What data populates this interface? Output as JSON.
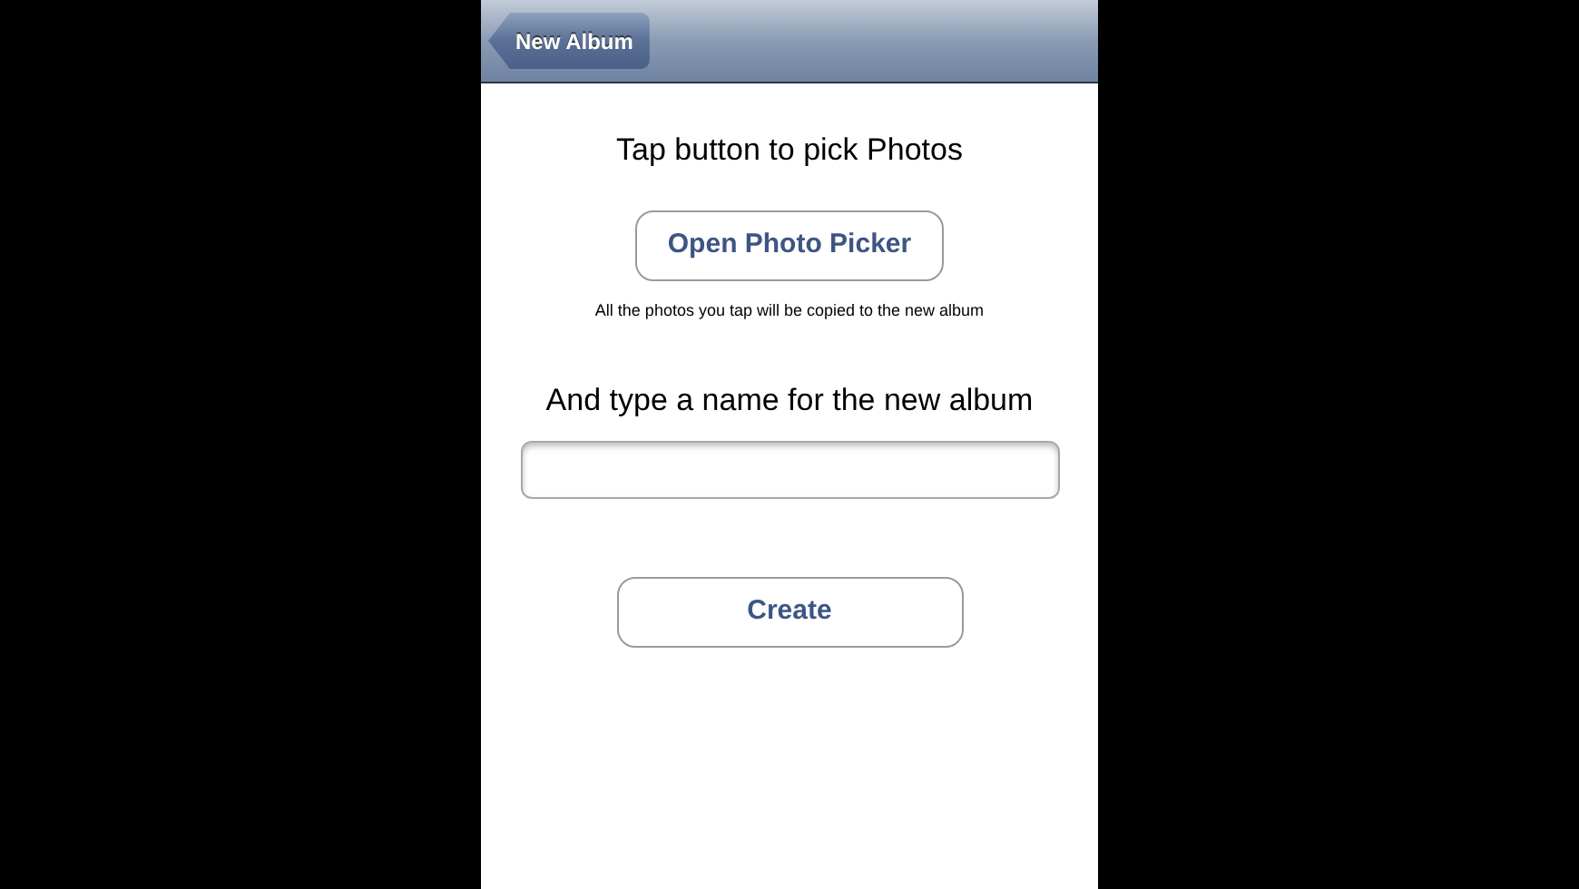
{
  "nav_bar": {
    "back_button": "New Album"
  },
  "pick_prompt": "Tap button to pick Photos",
  "picker_button": "Open Photo Picker",
  "picker_hint": "All the photos you tap will be copied to the new album",
  "name_prompt": "And type a name for the new album",
  "create_button": "Create"
}
